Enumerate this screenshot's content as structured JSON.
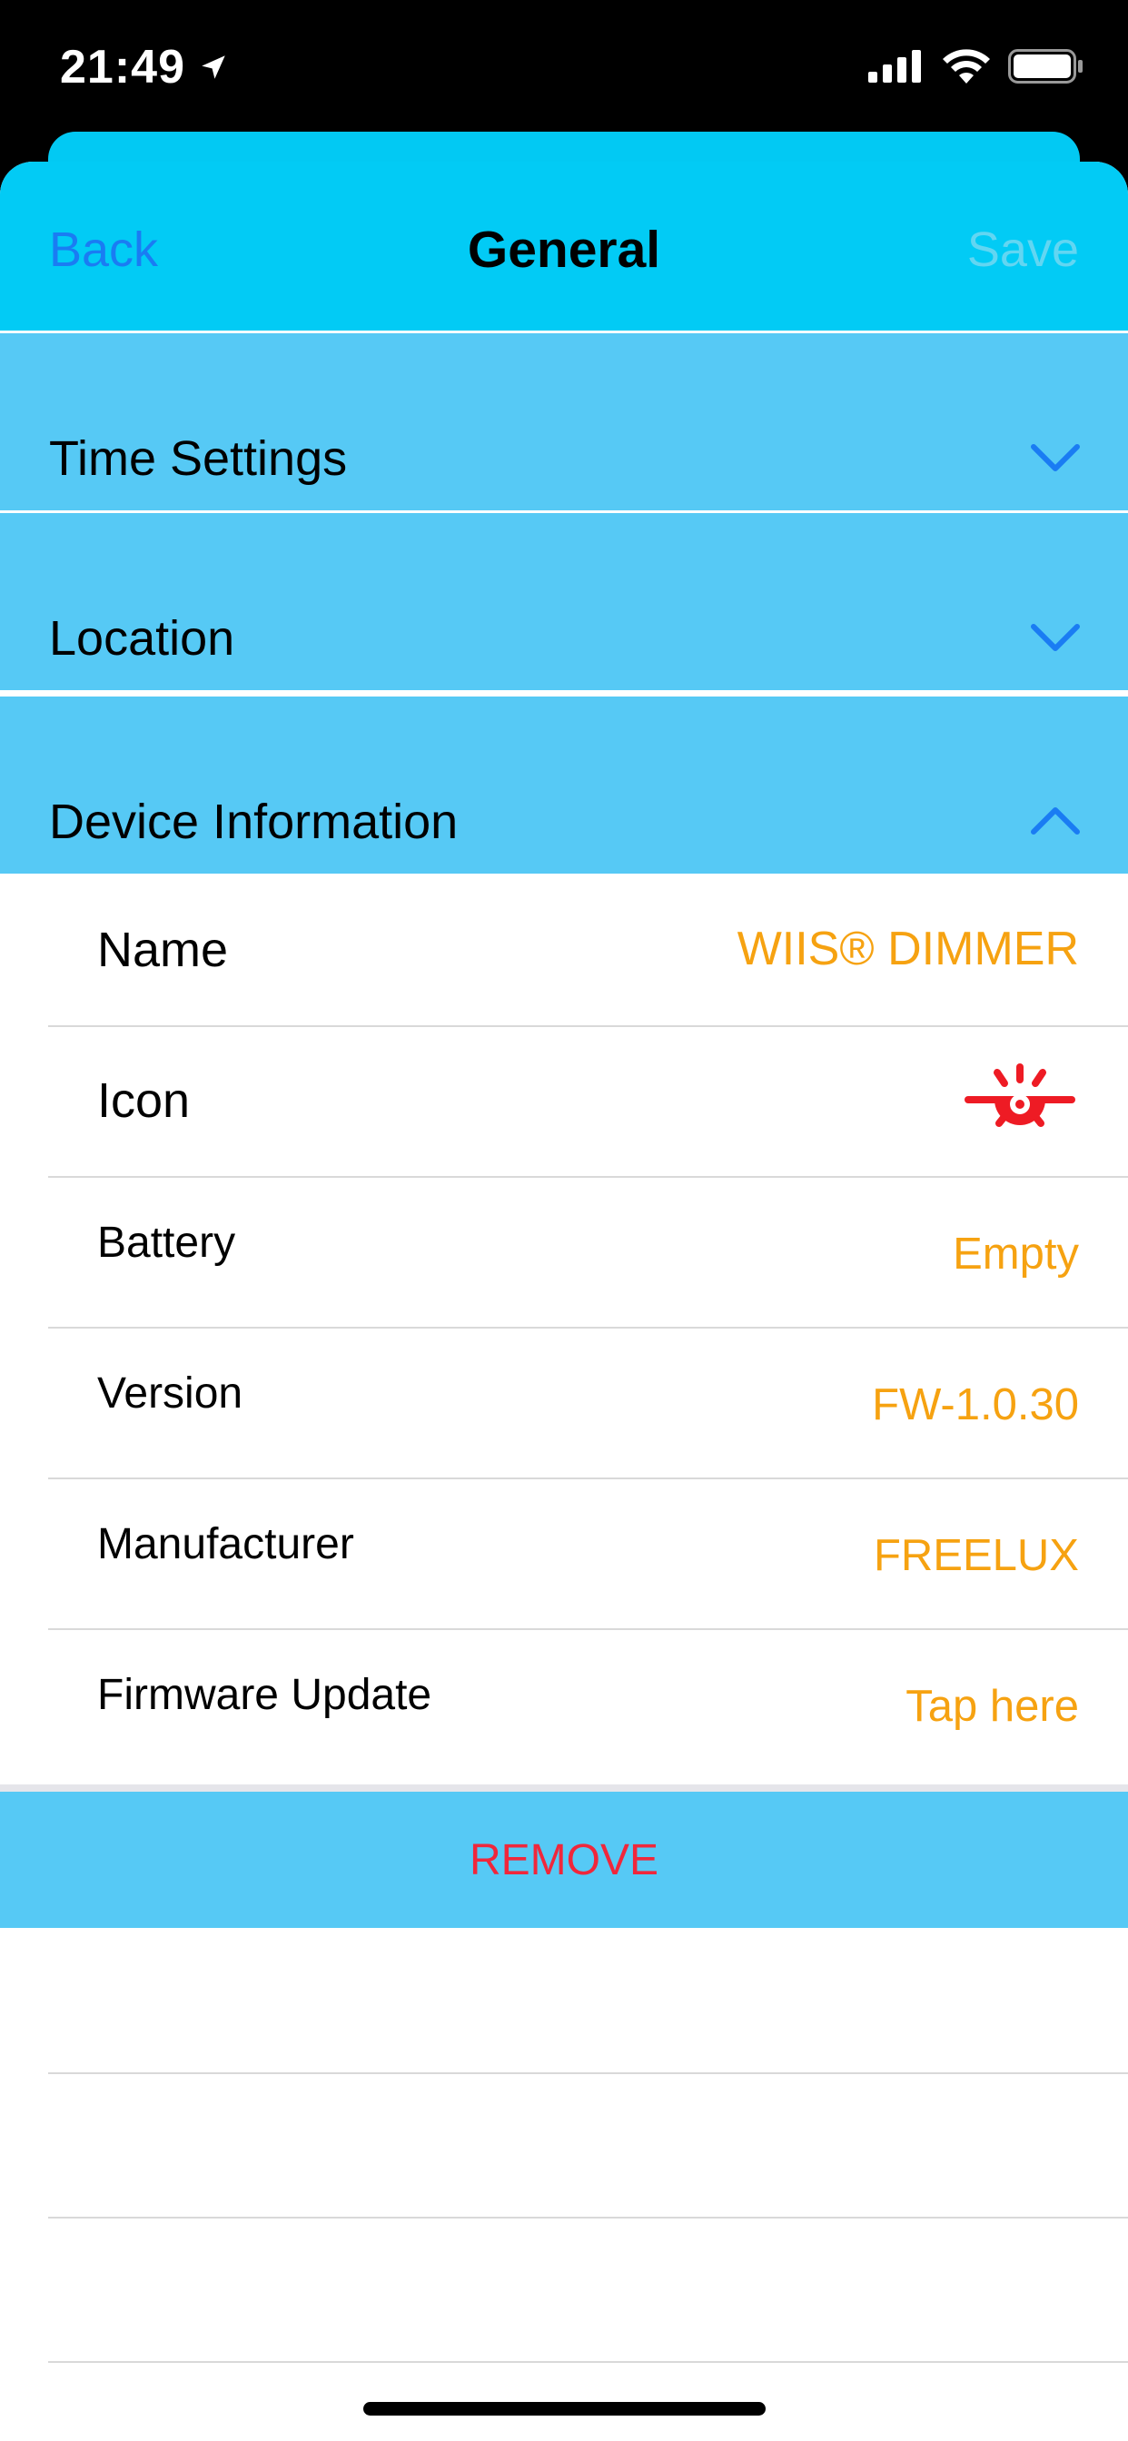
{
  "status_bar": {
    "time": "21:49",
    "icons": [
      "location-arrow-icon",
      "cellular-signal-icon",
      "wifi-icon",
      "battery-icon"
    ]
  },
  "nav": {
    "back_label": "Back",
    "title": "General",
    "save_label": "Save"
  },
  "sections": [
    {
      "label": "Time Settings",
      "expanded": false
    },
    {
      "label": "Location",
      "expanded": false
    },
    {
      "label": "Device Information",
      "expanded": true
    }
  ],
  "device_info": {
    "name": {
      "label": "Name",
      "value": "WIIS® DIMMER"
    },
    "icon": {
      "label": "Icon",
      "value_icon": "light-bulb-burst-icon"
    },
    "battery": {
      "label": "Battery",
      "value": "Empty"
    },
    "version": {
      "label": "Version",
      "value": "FW-1.0.30"
    },
    "manufacturer": {
      "label": "Manufacturer",
      "value": "FREELUX"
    },
    "firmware_update": {
      "label": "Firmware Update",
      "value": "Tap here"
    }
  },
  "remove_label": "REMOVE",
  "colors": {
    "header": "#02cbf5",
    "section": "#56c9f5",
    "accent_link": "#1a7cf3",
    "value_text": "#f6a211",
    "danger": "#f0273b",
    "device_icon": "#ee1b24"
  }
}
